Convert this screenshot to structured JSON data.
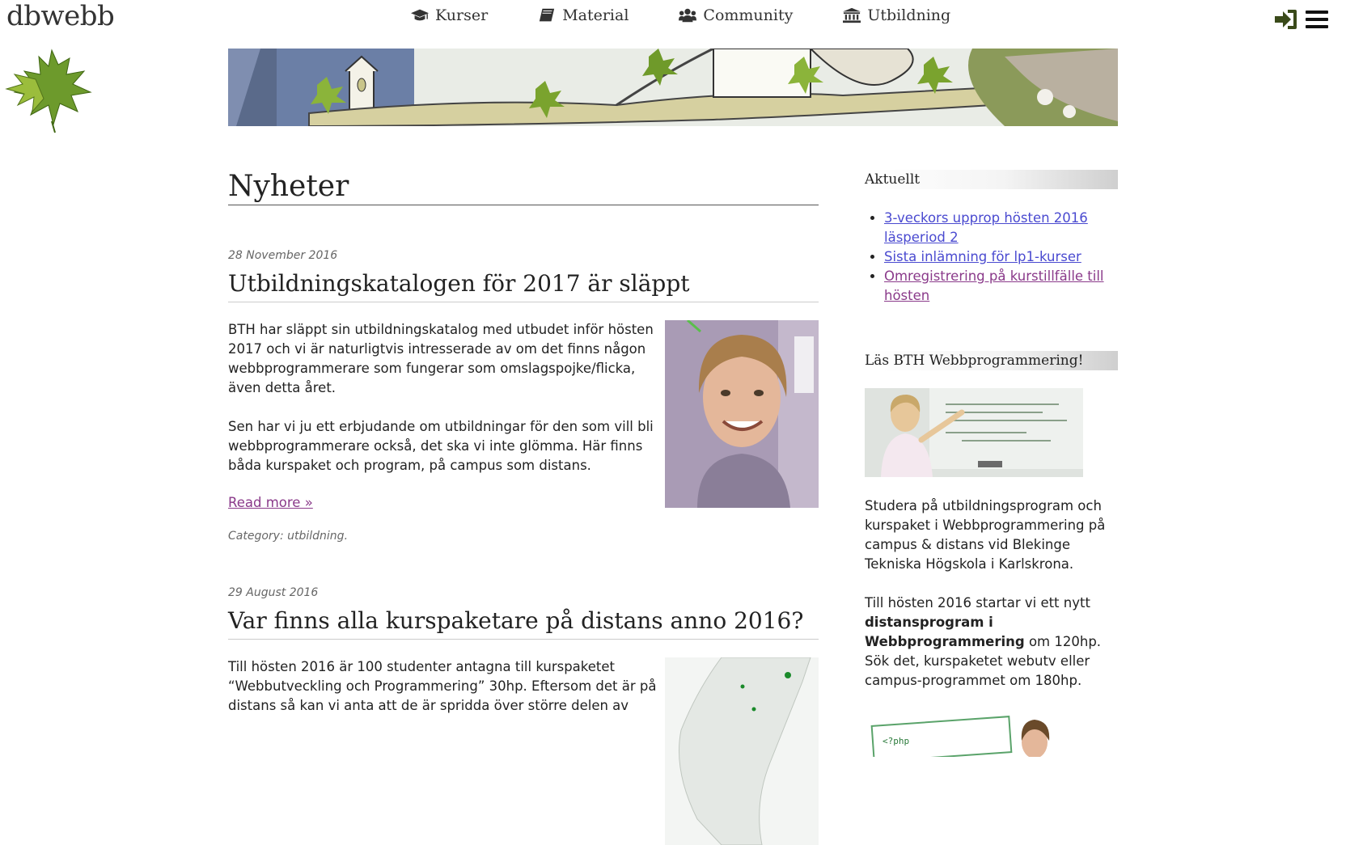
{
  "site": {
    "title": "dbwebb"
  },
  "nav": [
    {
      "label": "Kurser",
      "icon": "graduation-cap-icon"
    },
    {
      "label": "Material",
      "icon": "book-icon"
    },
    {
      "label": "Community",
      "icon": "users-icon"
    },
    {
      "label": "Utbildning",
      "icon": "institution-icon"
    }
  ],
  "header_icons": {
    "login": "sign-in-icon",
    "menu": "hamburger-menu-icon"
  },
  "main": {
    "title": "Nyheter",
    "posts": [
      {
        "date": "28 November 2016",
        "title": "Utbildningskatalogen för 2017 är släppt",
        "paragraphs": [
          "BTH har släppt sin utbildningskatalog med utbudet inför hösten 2017 och vi är naturligtvis intresserade av om det finns någon webbprogrammerare som fungerar som omslagspojke/flicka, även detta året.",
          "Sen har vi ju ett erbjudande om utbildningar för den som vill bli webbprogrammerare också, det ska vi inte glömma. Här finns båda kurspaket och program, på campus som distans."
        ],
        "read_more": "Read more »",
        "category_label": "Category:",
        "category": "utbildning."
      },
      {
        "date": "29 August 2016",
        "title": "Var finns alla kurspaketare på distans anno 2016?",
        "paragraphs": [
          "Till hösten 2016 är 100 studenter antagna till kurspaketet “Webbutveckling och Programmering” 30hp. Eftersom det är på distans så kan vi anta att de är spridda över större delen av"
        ]
      }
    ]
  },
  "sidebar": {
    "aktuellt": {
      "heading": "Aktuellt",
      "items": [
        "3-veckors upprop hösten 2016 läsperiod 2",
        "Sista inlämning för lp1-kurser",
        "Omregistrering på kurstillfälle till hösten"
      ]
    },
    "las": {
      "heading": "Läs BTH Webbprogrammering!",
      "p1": "Studera på utbildningsprogram och kurspaket i Webbprogrammering på campus & distans vid Blekinge Tekniska Högskola i Karlskrona.",
      "p2_start": "Till hösten 2016 startar vi ett nytt ",
      "p2_bold": "distansprogram i Webbprogrammering",
      "p2_end": " om 120hp. Sök det, kurspaketet webutv eller campus-programmet om 180hp.",
      "card_code": "<?php"
    }
  },
  "colors": {
    "link": "#4a4ad0",
    "visited": "#8a3a8a",
    "leaf": "#6f9a2a"
  }
}
